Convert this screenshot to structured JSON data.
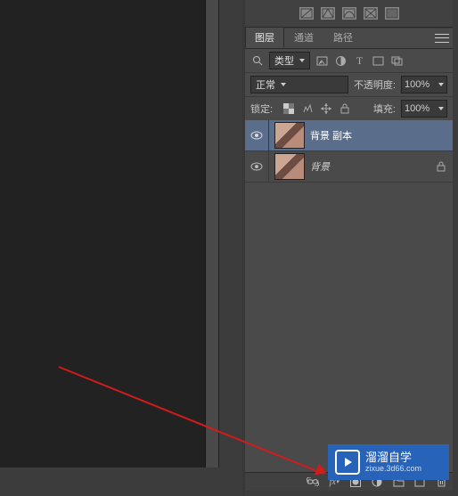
{
  "tabs": {
    "layers": "图层",
    "channels": "通道",
    "paths": "路径"
  },
  "filter": {
    "kind_label": "类型"
  },
  "blend": {
    "mode": "正常",
    "opacity_label": "不透明度:",
    "opacity_value": "100%"
  },
  "lock": {
    "label": "锁定:",
    "fill_label": "填充:",
    "fill_value": "100%"
  },
  "layers": [
    {
      "name": "背景 副本",
      "selected": true,
      "locked": false
    },
    {
      "name": "背景",
      "selected": false,
      "locked": true
    }
  ],
  "watermark": {
    "title": "溜溜自学",
    "url": "zixue.3d66.com"
  },
  "bottom_icons": [
    "link-icon",
    "fx-icon",
    "mask-icon",
    "adjust-icon",
    "group-icon",
    "new-layer-icon",
    "trash-icon"
  ]
}
